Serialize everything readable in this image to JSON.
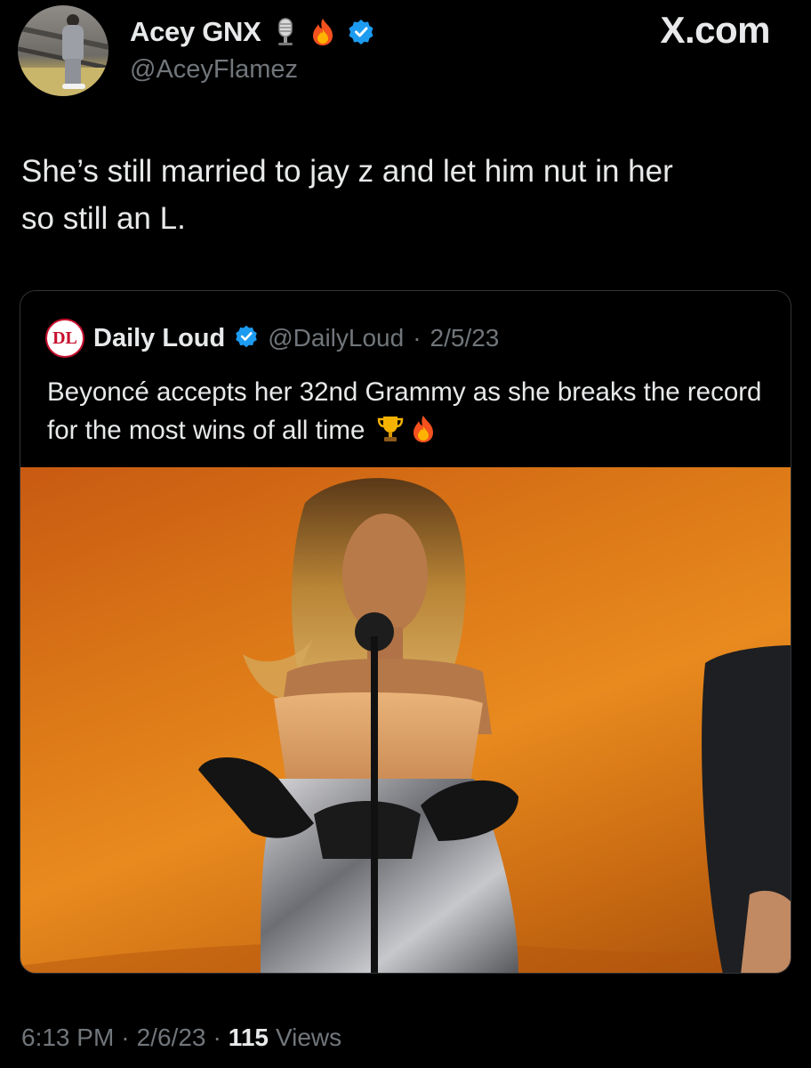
{
  "header": {
    "display_name": "Acey GNX",
    "handle": "@AceyFlamez",
    "site_label": "X.com",
    "badges": [
      "microphone-icon",
      "fire-icon",
      "verified-badge-icon"
    ]
  },
  "tweet": {
    "text": "She’s still married to jay z and let him nut in her\nso still an L."
  },
  "quote": {
    "name": "Daily Loud",
    "handle": "@DailyLoud",
    "separator": "·",
    "date": "2/5/23",
    "text": "Beyoncé accepts her 32nd Grammy as she breaks the record for the most wins of all time",
    "icons": [
      "trophy-icon",
      "fire-icon"
    ],
    "avatar_initials": "DL",
    "image_description_icon": "photo"
  },
  "footer": {
    "time": "6:13 PM",
    "sep1": "·",
    "date": "2/6/23",
    "sep2": "·",
    "views_count": "115",
    "views_label": "Views"
  },
  "colors": {
    "background": "#000000",
    "text": "#e7e9ea",
    "muted": "#71767b",
    "verified": "#1d9bf0",
    "card_border": "#2f3336"
  }
}
